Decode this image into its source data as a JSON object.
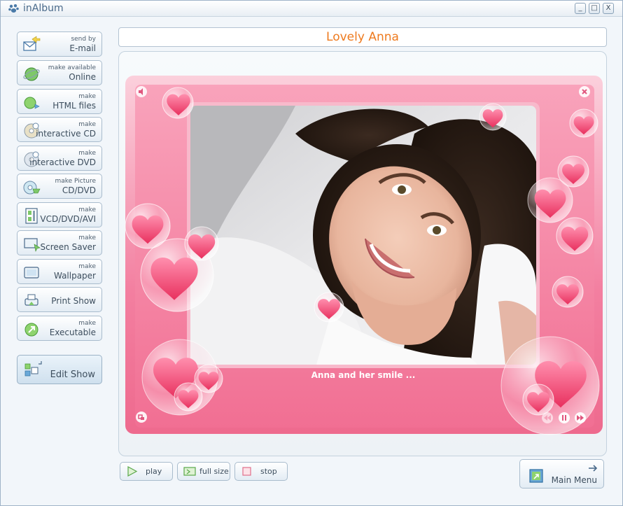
{
  "app": {
    "title": "inAlbum",
    "window_controls": [
      "_",
      "□",
      "X"
    ]
  },
  "sidebar": {
    "items": [
      {
        "line1": "send by",
        "line2": "E-mail",
        "icon": "email-send-icon"
      },
      {
        "line1": "make available",
        "line2": "Online",
        "icon": "globe-online-icon"
      },
      {
        "line1": "make",
        "line2": "HTML files",
        "icon": "html-upload-icon"
      },
      {
        "line1": "make",
        "line2": "interactive CD",
        "icon": "cd-icon"
      },
      {
        "line1": "make",
        "line2": "interactive DVD",
        "icon": "dvd-icon"
      },
      {
        "line1": "make Picture",
        "line2": "CD/DVD",
        "icon": "picture-cd-icon"
      },
      {
        "line1": "make",
        "line2": "VCD/DVD/AVI",
        "icon": "video-icon"
      },
      {
        "line1": "make",
        "line2": "Screen Saver",
        "icon": "screensaver-icon"
      },
      {
        "line1": "make",
        "line2": "Wallpaper",
        "icon": "wallpaper-icon"
      },
      {
        "line1": "Print Show",
        "line2": "",
        "icon": "print-icon"
      },
      {
        "line1": "make",
        "line2": "Executable",
        "icon": "executable-icon"
      }
    ],
    "edit": {
      "label": "Edit Show",
      "icon": "edit-show-icon"
    }
  },
  "show": {
    "title": "Lovely Anna",
    "caption": "Anna and her smile ...",
    "colors": {
      "title": "#ee7a1e",
      "frame": "#f37fa0",
      "frame_light": "#fbd0dc"
    }
  },
  "controls": {
    "play": "play",
    "full_size": "full size",
    "stop": "stop",
    "main_menu": "Main Menu"
  }
}
